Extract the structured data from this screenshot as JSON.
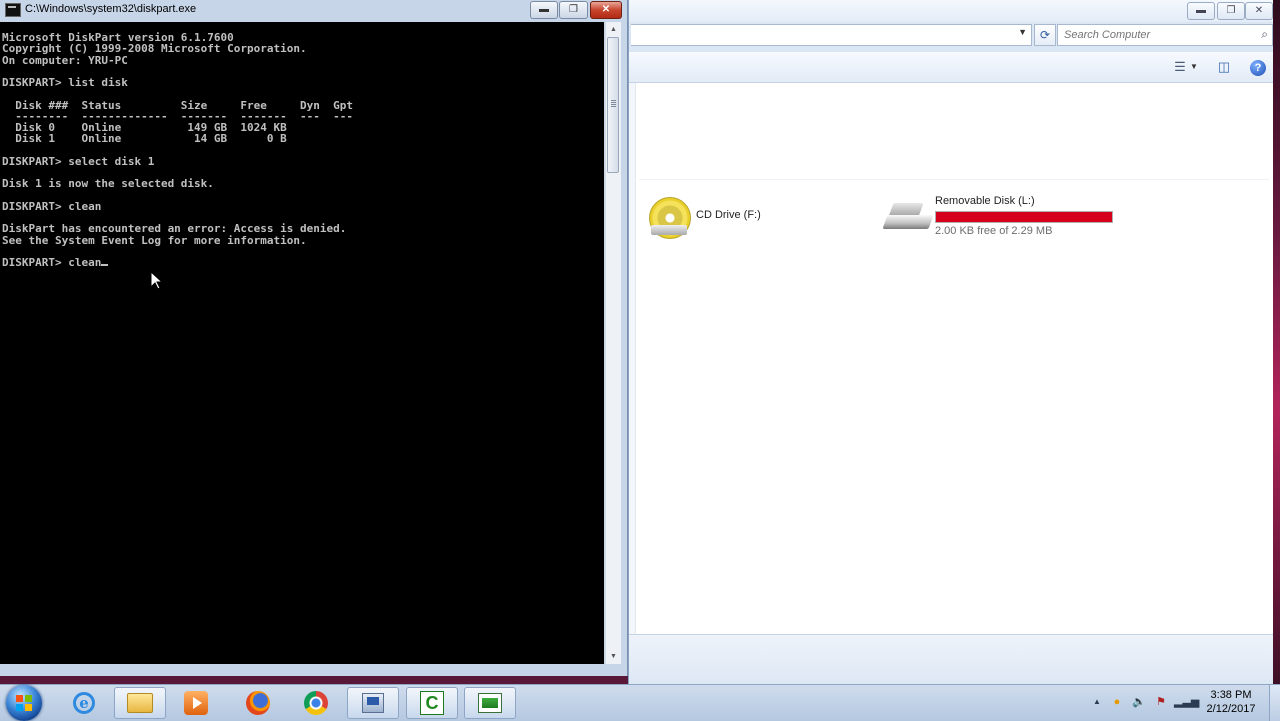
{
  "console": {
    "title": "C:\\Windows\\system32\\diskpart.exe",
    "lines": [
      "Microsoft DiskPart version 6.1.7600",
      "Copyright (C) 1999-2008 Microsoft Corporation.",
      "On computer: YRU-PC",
      "",
      "DISKPART> list disk",
      "",
      "  Disk ###  Status         Size     Free     Dyn  Gpt",
      "  --------  -------------  -------  -------  ---  ---",
      "  Disk 0    Online          149 GB  1024 KB",
      "  Disk 1    Online           14 GB      0 B",
      "",
      "DISKPART> select disk 1",
      "",
      "Disk 1 is now the selected disk.",
      "",
      "DISKPART> clean",
      "",
      "DiskPart has encountered an error: Access is denied.",
      "See the System Event Log for more information.",
      "",
      "DISKPART> clean"
    ],
    "scrollbar": {
      "position": 0
    }
  },
  "explorer": {
    "search_placeholder": "Search Computer",
    "drives": [
      {
        "label": "CD Drive (F:)",
        "icon": "cd-drive-icon"
      },
      {
        "label": "Removable Disk (L:)",
        "free_text": "2.00 KB free of 2.29 MB",
        "used_fraction": 0.999,
        "icon": "removable-disk-icon"
      }
    ],
    "usage_bar_color": "#d7001c"
  },
  "taskbar": {
    "apps": [
      {
        "name": "internet-explorer",
        "icon": "internet-explorer-icon"
      },
      {
        "name": "windows-explorer",
        "icon": "folder-icon"
      },
      {
        "name": "media-player",
        "icon": "media-player-icon"
      },
      {
        "name": "firefox",
        "icon": "firefox-icon"
      },
      {
        "name": "chrome",
        "icon": "chrome-icon"
      },
      {
        "name": "network",
        "icon": "network-icon"
      },
      {
        "name": "camtasia",
        "icon": "camtasia-icon"
      },
      {
        "name": "command-prompt",
        "icon": "command-prompt-icon"
      }
    ],
    "clock": {
      "time": "3:38 PM",
      "date": "2/12/2017"
    }
  }
}
